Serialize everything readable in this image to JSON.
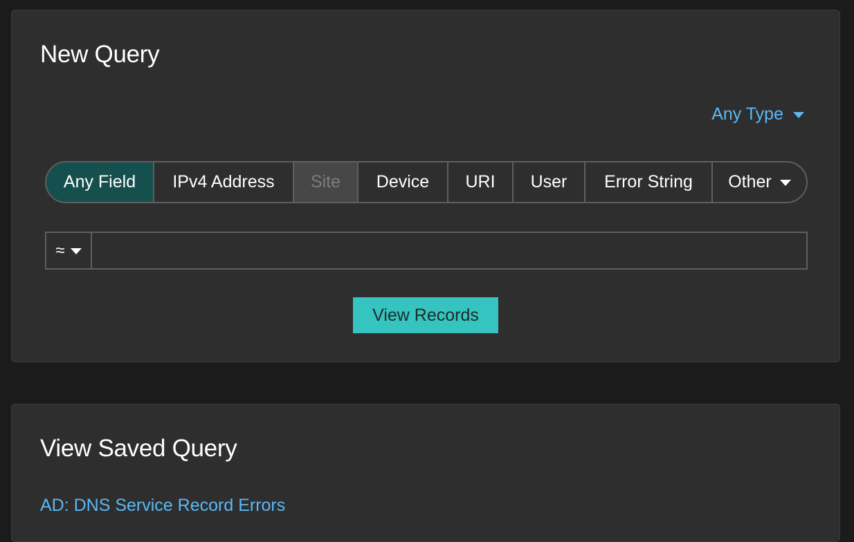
{
  "new_query": {
    "title": "New Query",
    "type_dropdown": {
      "label": "Any Type"
    },
    "field_tabs": [
      {
        "label": "Any Field",
        "state": "active"
      },
      {
        "label": "IPv4 Address",
        "state": "normal"
      },
      {
        "label": "Site",
        "state": "disabled"
      },
      {
        "label": "Device",
        "state": "normal"
      },
      {
        "label": "URI",
        "state": "normal"
      },
      {
        "label": "User",
        "state": "normal"
      },
      {
        "label": "Error String",
        "state": "normal"
      },
      {
        "label": "Other",
        "state": "normal"
      }
    ],
    "operator": {
      "value": "≈"
    },
    "query_input": {
      "value": "",
      "placeholder": ""
    },
    "submit_label": "View Records"
  },
  "saved_query": {
    "title": "View Saved Query",
    "items": [
      {
        "label": "AD: DNS Service Record Errors"
      }
    ]
  },
  "colors": {
    "background": "#1b1b1b",
    "panel": "#2e2e2e",
    "link": "#5bb8f5",
    "active_tab": "#15504e",
    "disabled_tab": "#474747",
    "primary_button": "#35c4bf"
  }
}
